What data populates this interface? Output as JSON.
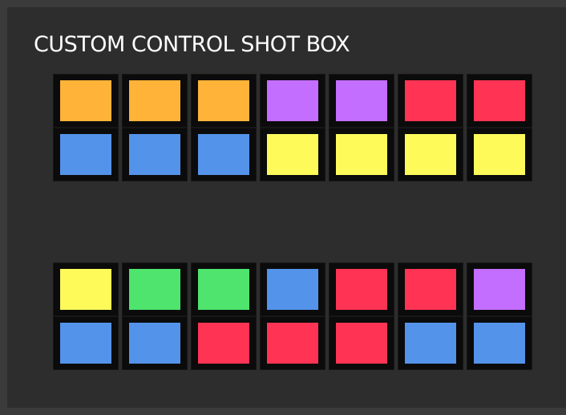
{
  "title": "CUSTOM CONTROL SHOT BOX",
  "colors": {
    "orange": "#FFB338",
    "purple": "#C46EFF",
    "red": "#FF3454",
    "blue": "#5493EA",
    "yellow": "#FEFA5A",
    "green": "#4EE46D"
  },
  "groups": [
    {
      "rows": [
        [
          "orange",
          "orange",
          "orange",
          "purple",
          "purple",
          "red",
          "red"
        ],
        [
          "blue",
          "blue",
          "blue",
          "yellow",
          "yellow",
          "yellow",
          "yellow"
        ]
      ]
    },
    {
      "rows": [
        [
          "yellow",
          "green",
          "green",
          "blue",
          "red",
          "red",
          "purple"
        ],
        [
          "blue",
          "blue",
          "red",
          "red",
          "red",
          "blue",
          "blue"
        ]
      ]
    }
  ]
}
